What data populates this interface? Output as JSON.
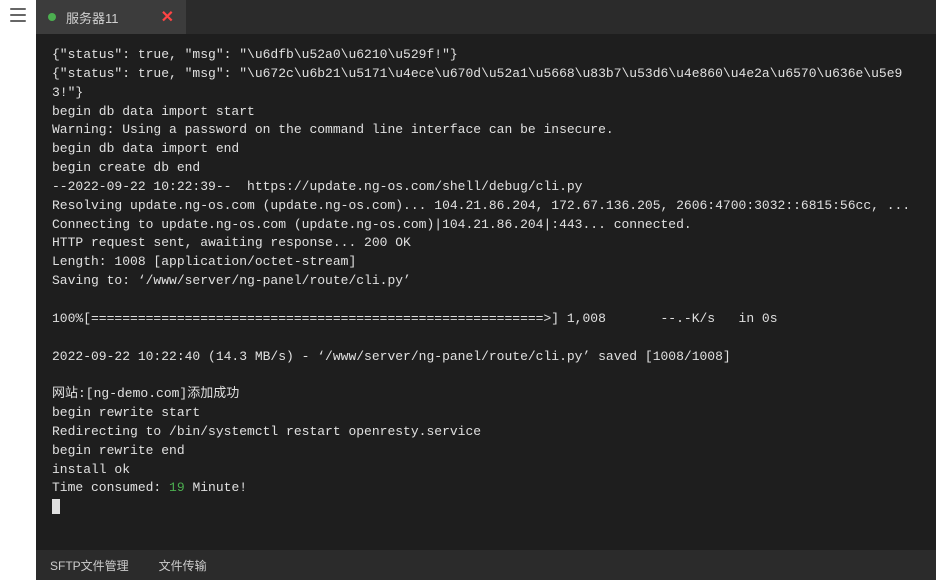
{
  "tab": {
    "title": "服务器11"
  },
  "terminal": {
    "lines": [
      {
        "text": "{\"status\": true, \"msg\": \"\\u6dfb\\u52a0\\u6210\\u529f!\"}"
      },
      {
        "text": "{\"status\": true, \"msg\": \"\\u672c\\u6b21\\u5171\\u4ece\\u670d\\u52a1\\u5668\\u83b7\\u53d6\\u4e860\\u4e2a\\u6570\\u636e\\u5e93!\"}"
      },
      {
        "text": "begin db data import start"
      },
      {
        "text": "Warning: Using a password on the command line interface can be insecure."
      },
      {
        "text": "begin db data import end"
      },
      {
        "text": "begin create db end"
      },
      {
        "text": "--2022-09-22 10:22:39--  https://update.ng-os.com/shell/debug/cli.py"
      },
      {
        "text": "Resolving update.ng-os.com (update.ng-os.com)... 104.21.86.204, 172.67.136.205, 2606:4700:3032::6815:56cc, ..."
      },
      {
        "text": "Connecting to update.ng-os.com (update.ng-os.com)|104.21.86.204|:443... connected."
      },
      {
        "text": "HTTP request sent, awaiting response... 200 OK"
      },
      {
        "text": "Length: 1008 [application/octet-stream]"
      },
      {
        "text": "Saving to: ‘/www/server/ng-panel/route/cli.py’"
      },
      {
        "text": ""
      },
      {
        "text": "100%[==========================================================>] 1,008       --.-K/s   in 0s"
      },
      {
        "text": ""
      },
      {
        "text": "2022-09-22 10:22:40 (14.3 MB/s) - ‘/www/server/ng-panel/route/cli.py’ saved [1008/1008]"
      },
      {
        "text": ""
      },
      {
        "text": "网站:[ng-demo.com]添加成功"
      },
      {
        "text": "begin rewrite start"
      },
      {
        "text": "Redirecting to /bin/systemctl restart openresty.service"
      },
      {
        "text": "begin rewrite end"
      },
      {
        "text": "install ok"
      },
      {
        "prefix": "Time consumed: ",
        "highlight": "19",
        "suffix": " Minute!"
      }
    ]
  },
  "bottom": {
    "sftp": "SFTP文件管理",
    "transfer": "文件传输"
  }
}
